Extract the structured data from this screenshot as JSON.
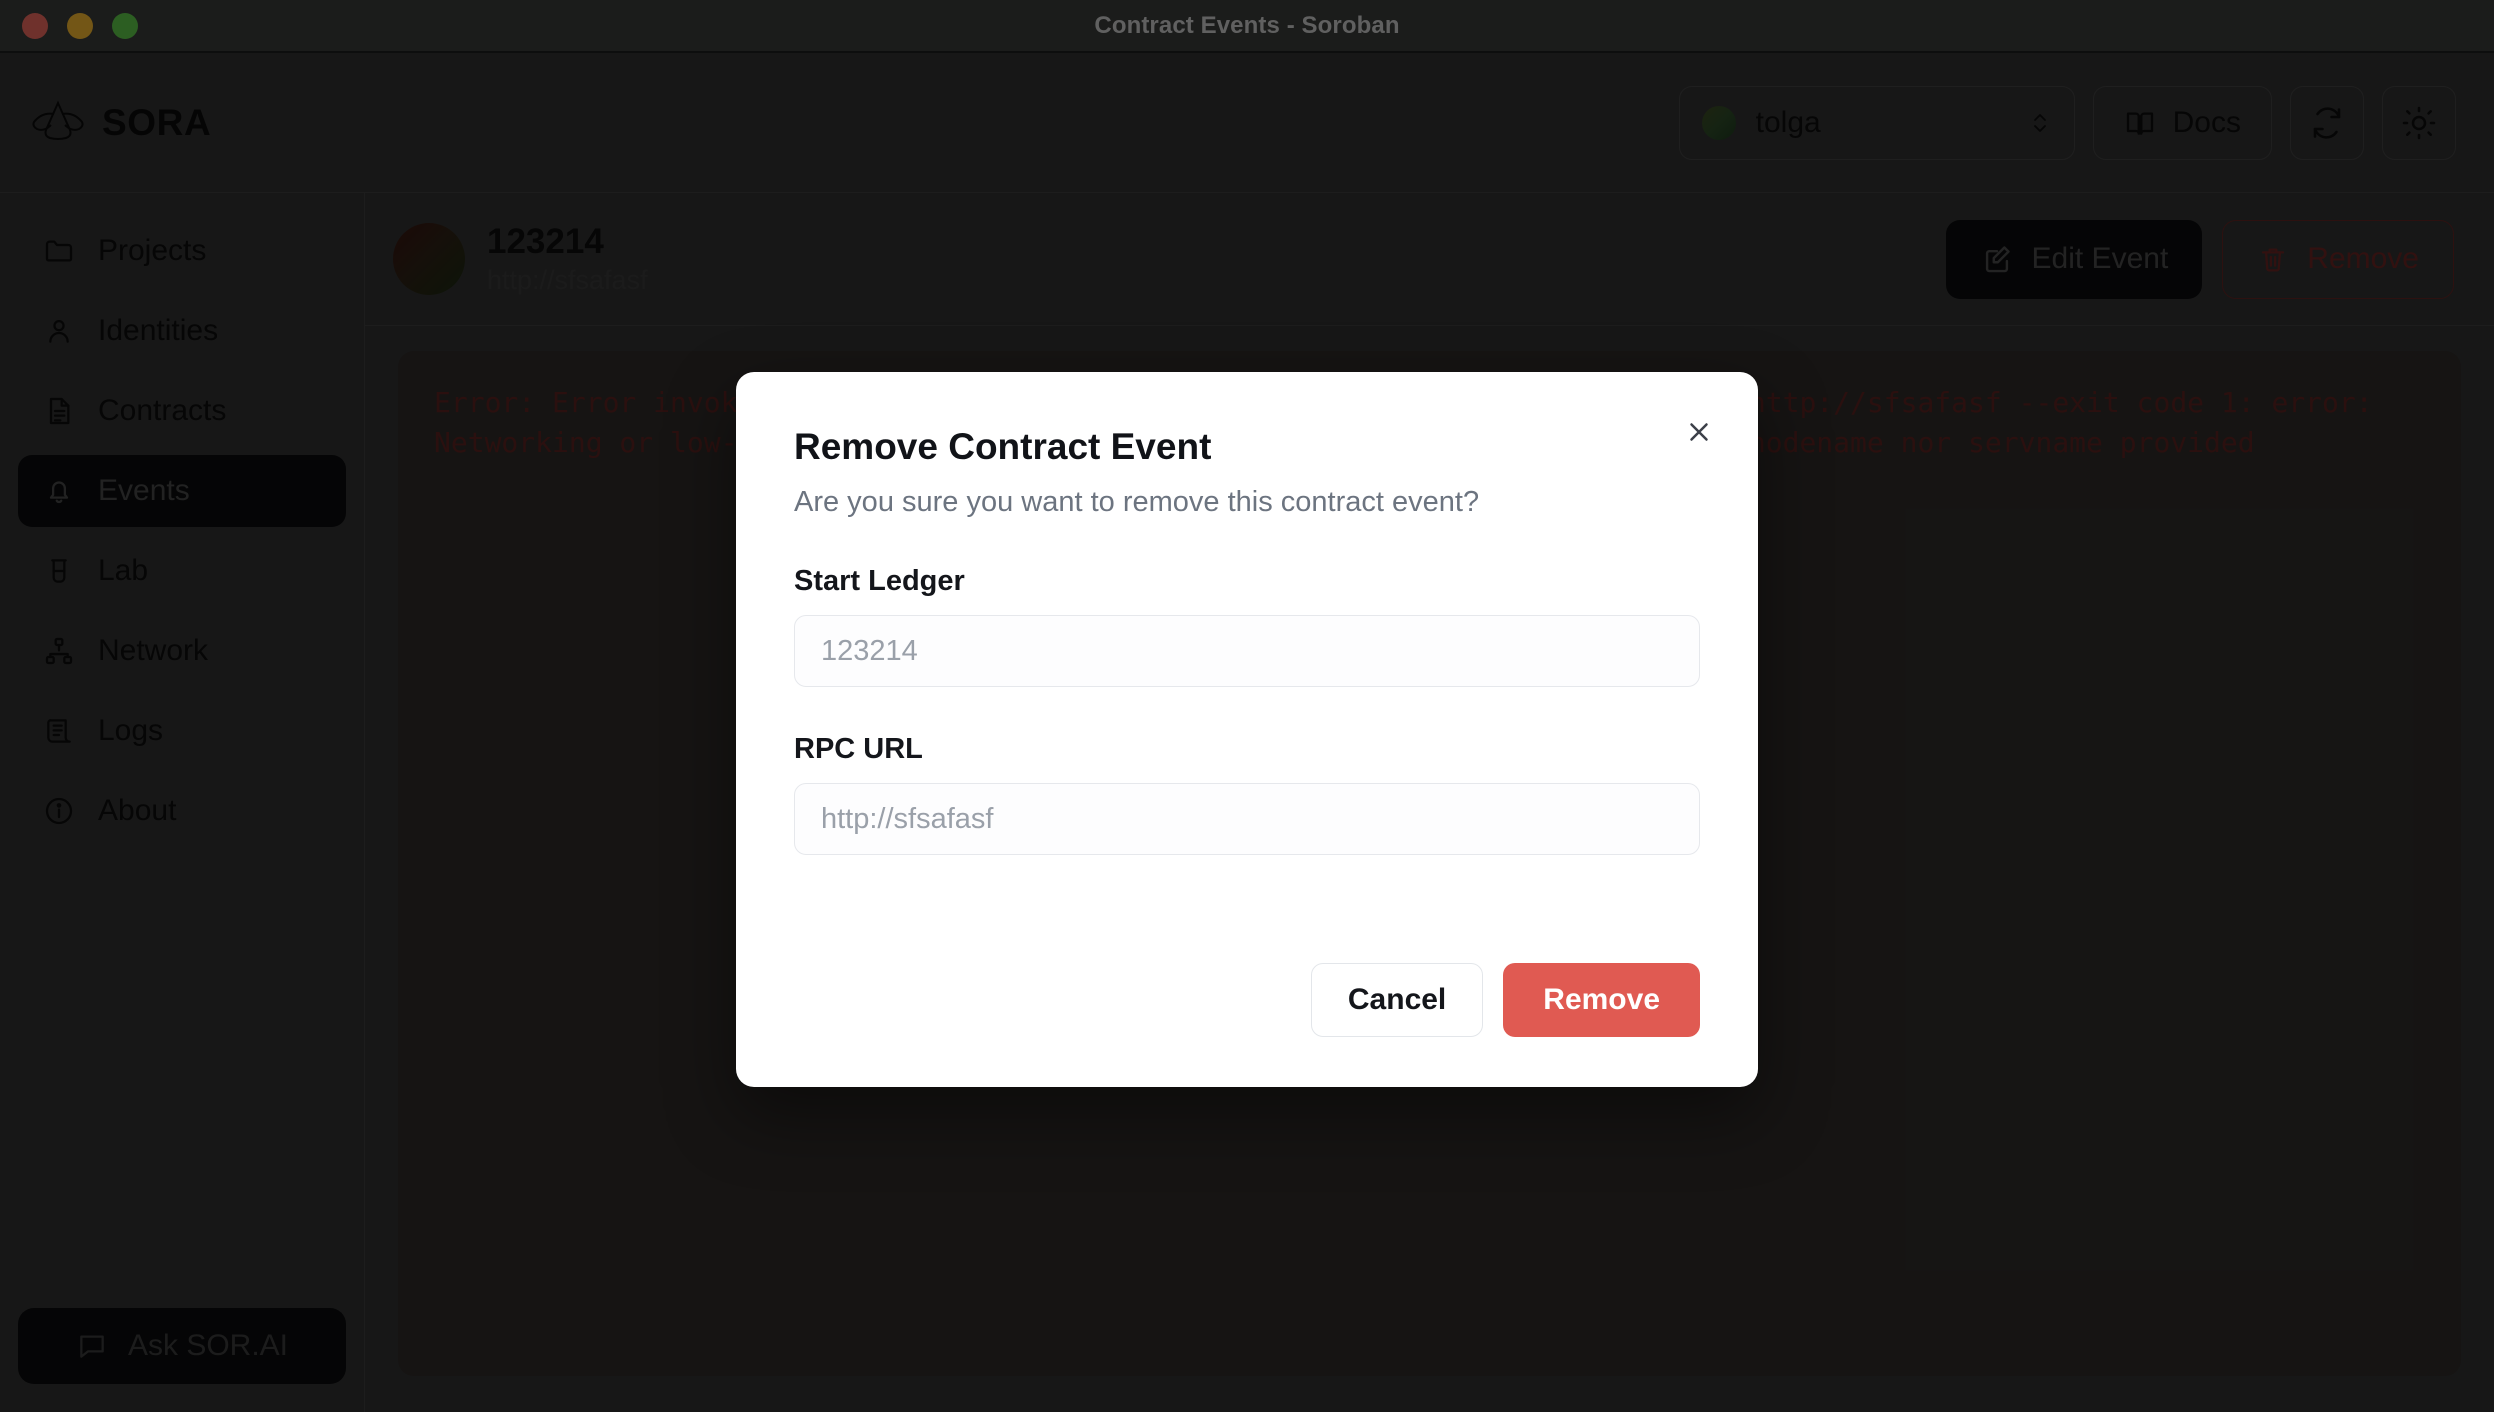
{
  "window": {
    "title": "Contract Events - Soroban",
    "traffic_lights": [
      "close",
      "minimize",
      "maximize"
    ]
  },
  "topbar": {
    "brand": "SORA",
    "account": {
      "name": "tolga",
      "icon": "avatar-circle",
      "chevron": "chevron-updown-icon"
    },
    "docs": {
      "label": "Docs",
      "icon": "book-icon"
    },
    "refresh": {
      "icon": "refresh-icon"
    },
    "theme": {
      "icon": "sun-icon"
    }
  },
  "sidebar": {
    "items": [
      {
        "label": "Projects",
        "icon": "folder-icon",
        "active": false
      },
      {
        "label": "Identities",
        "icon": "user-icon",
        "active": false
      },
      {
        "label": "Contracts",
        "icon": "document-icon",
        "active": false
      },
      {
        "label": "Events",
        "icon": "bell-icon",
        "active": true
      },
      {
        "label": "Lab",
        "icon": "beaker-icon",
        "active": false
      },
      {
        "label": "Network",
        "icon": "sitemap-icon",
        "active": false
      },
      {
        "label": "Logs",
        "icon": "scroll-icon",
        "active": false
      },
      {
        "label": "About",
        "icon": "info-icon",
        "active": false
      }
    ],
    "ask": {
      "label": "Ask SOR.AI",
      "icon": "chat-icon"
    }
  },
  "page": {
    "event_title": "123214",
    "event_url": "http://sfsafasf",
    "edit_button": {
      "label": "Edit Event",
      "icon": "pencil-square-icon"
    },
    "remove_button": {
      "label": "Remove",
      "icon": "trash-icon"
    }
  },
  "console": {
    "text": "Error: Error invoking stellar contract events --start-ledger 123214 --rpc-url http://sfsafasf --exit code 1: error: Networking or low-level protocol error: failed to lookup address information: nodename nor servname provided"
  },
  "modal": {
    "title": "Remove Contract Event",
    "subtitle": "Are you sure you want to remove this contract event?",
    "close_icon": "close-icon",
    "fields": [
      {
        "label": "Start Ledger",
        "value": "",
        "placeholder": "123214"
      },
      {
        "label": "RPC URL",
        "value": "",
        "placeholder": "http://sfsafasf"
      }
    ],
    "cancel_label": "Cancel",
    "confirm_label": "Remove"
  },
  "colors": {
    "danger": "#e05a52",
    "danger_outline": "#6a2523",
    "window_bg": "#313131",
    "titlebar_bg": "#393b3a",
    "active_nav_bg": "#0b0c0d",
    "console_bg": "#2f2b29",
    "console_text": "#5a2220"
  }
}
